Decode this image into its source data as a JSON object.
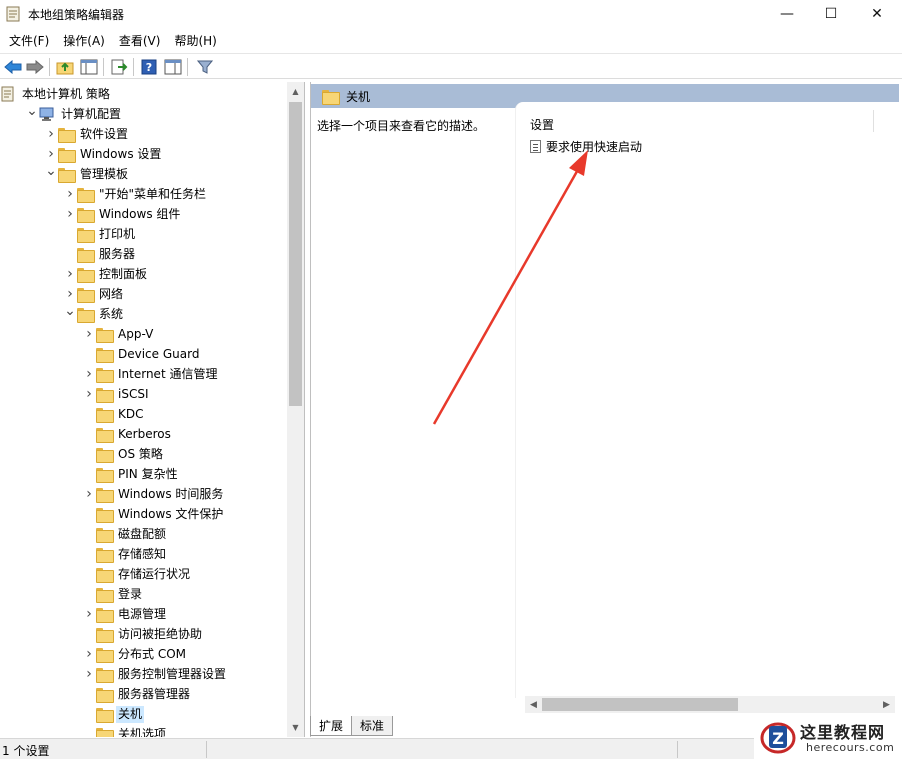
{
  "window": {
    "title": "本地组策略编辑器",
    "min_glyph": "—",
    "max_glyph": "☐",
    "close_glyph": "✕"
  },
  "menu": [
    "文件(F)",
    "操作(A)",
    "查看(V)",
    "帮助(H)"
  ],
  "tree": [
    {
      "label": "本地计算机 策略",
      "level": 0,
      "chevron": "",
      "icon": "policy-doc-icon"
    },
    {
      "label": "计算机配置",
      "level": 1,
      "chevron": "down",
      "icon": "computer-icon"
    },
    {
      "label": "软件设置",
      "level": 2,
      "chevron": "right",
      "icon": "folder-icon"
    },
    {
      "label": "Windows 设置",
      "level": 2,
      "chevron": "right",
      "icon": "folder-icon"
    },
    {
      "label": "管理模板",
      "level": 2,
      "chevron": "down",
      "icon": "folder-icon"
    },
    {
      "label": "\"开始\"菜单和任务栏",
      "level": 3,
      "chevron": "right",
      "icon": "folder-icon"
    },
    {
      "label": "Windows 组件",
      "level": 3,
      "chevron": "right",
      "icon": "folder-icon"
    },
    {
      "label": "打印机",
      "level": 3,
      "chevron": "",
      "icon": "folder-icon"
    },
    {
      "label": "服务器",
      "level": 3,
      "chevron": "",
      "icon": "folder-icon"
    },
    {
      "label": "控制面板",
      "level": 3,
      "chevron": "right",
      "icon": "folder-icon"
    },
    {
      "label": "网络",
      "level": 3,
      "chevron": "right",
      "icon": "folder-icon"
    },
    {
      "label": "系统",
      "level": 3,
      "chevron": "down",
      "icon": "folder-icon"
    },
    {
      "label": "App-V",
      "level": 4,
      "chevron": "right",
      "icon": "folder-icon"
    },
    {
      "label": "Device Guard",
      "level": 4,
      "chevron": "",
      "icon": "folder-icon"
    },
    {
      "label": "Internet 通信管理",
      "level": 4,
      "chevron": "right",
      "icon": "folder-icon"
    },
    {
      "label": "iSCSI",
      "level": 4,
      "chevron": "right",
      "icon": "folder-icon"
    },
    {
      "label": "KDC",
      "level": 4,
      "chevron": "",
      "icon": "folder-icon"
    },
    {
      "label": "Kerberos",
      "level": 4,
      "chevron": "",
      "icon": "folder-icon"
    },
    {
      "label": "OS 策略",
      "level": 4,
      "chevron": "",
      "icon": "folder-icon"
    },
    {
      "label": "PIN 复杂性",
      "level": 4,
      "chevron": "",
      "icon": "folder-icon"
    },
    {
      "label": "Windows 时间服务",
      "level": 4,
      "chevron": "right",
      "icon": "folder-icon"
    },
    {
      "label": "Windows 文件保护",
      "level": 4,
      "chevron": "",
      "icon": "folder-icon"
    },
    {
      "label": "磁盘配额",
      "level": 4,
      "chevron": "",
      "icon": "folder-icon"
    },
    {
      "label": "存储感知",
      "level": 4,
      "chevron": "",
      "icon": "folder-icon"
    },
    {
      "label": "存储运行状况",
      "level": 4,
      "chevron": "",
      "icon": "folder-icon"
    },
    {
      "label": "登录",
      "level": 4,
      "chevron": "",
      "icon": "folder-icon"
    },
    {
      "label": "电源管理",
      "level": 4,
      "chevron": "right",
      "icon": "folder-icon"
    },
    {
      "label": "访问被拒绝协助",
      "level": 4,
      "chevron": "",
      "icon": "folder-icon"
    },
    {
      "label": "分布式 COM",
      "level": 4,
      "chevron": "right",
      "icon": "folder-icon"
    },
    {
      "label": "服务控制管理器设置",
      "level": 4,
      "chevron": "right",
      "icon": "folder-icon"
    },
    {
      "label": "服务器管理器",
      "level": 4,
      "chevron": "",
      "icon": "folder-icon"
    },
    {
      "label": "关机",
      "level": 4,
      "chevron": "",
      "icon": "folder-icon",
      "selected": true
    },
    {
      "label": "关机选项",
      "level": 4,
      "chevron": "",
      "icon": "folder-icon"
    }
  ],
  "right": {
    "header_title": "关机",
    "description": "选择一个项目来查看它的描述。",
    "settings_header": "设置",
    "settings": [
      "要求使用快速启动"
    ]
  },
  "tabs": [
    "扩展",
    "标准"
  ],
  "status": {
    "text": "1 个设置"
  },
  "watermark": {
    "title": "这里教程网",
    "subtitle": "herecours.com",
    "logo_letter": "Z"
  },
  "colors": {
    "header_bg": "#a9bcd6",
    "selection": "#cce8ff",
    "arrow": "#e8392b",
    "folder": "#f7d676"
  }
}
